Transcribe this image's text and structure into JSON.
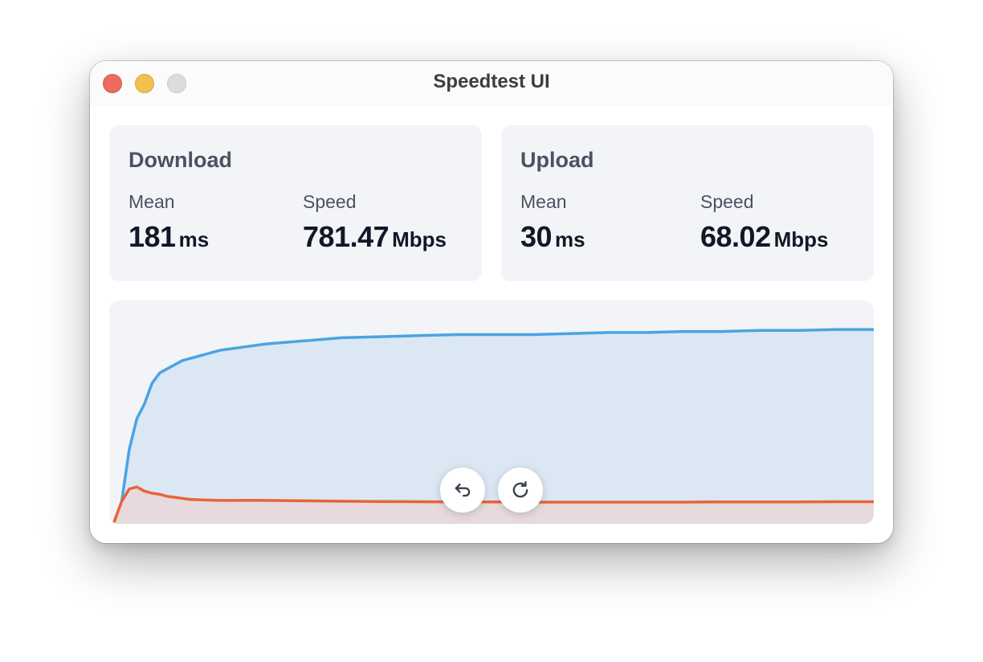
{
  "window": {
    "title": "Speedtest UI"
  },
  "download": {
    "title": "Download",
    "mean_label": "Mean",
    "mean_value": "181",
    "mean_unit": "ms",
    "speed_label": "Speed",
    "speed_value": "781.47",
    "speed_unit": "Mbps"
  },
  "upload": {
    "title": "Upload",
    "mean_label": "Mean",
    "mean_value": "30",
    "mean_unit": "ms",
    "speed_label": "Speed",
    "speed_value": "68.02",
    "speed_unit": "Mbps"
  },
  "buttons": {
    "undo_icon": "undo-arrow-icon",
    "reload_icon": "reload-icon"
  },
  "colors": {
    "download_line": "#4ba3e3",
    "download_fill": "#dbe8f3",
    "upload_line": "#e8643a",
    "upload_fill": "#e6dadc",
    "close": "#ec6a5e",
    "minimize": "#f4bf4f",
    "zoom": "#dcdcdc"
  },
  "chart_data": {
    "type": "area",
    "x": [
      0,
      1,
      2,
      3,
      4,
      5,
      6,
      7,
      8,
      9,
      10,
      12,
      14,
      16,
      18,
      20,
      25,
      30,
      35,
      40,
      45,
      50,
      55,
      60,
      65,
      70,
      75,
      80,
      85,
      90,
      95,
      100
    ],
    "series": [
      {
        "values": [
          0,
          10,
          35,
          50,
          57,
          67,
          72,
          74,
          76,
          78,
          79,
          81,
          83,
          84,
          85,
          86,
          87.5,
          89,
          89.5,
          90,
          90.5,
          90.5,
          90.5,
          91,
          91.5,
          91.5,
          92,
          92,
          92.5,
          92.5,
          93,
          93
        ]
      },
      {
        "values": [
          0,
          10,
          16,
          17,
          15,
          14,
          13.5,
          12.5,
          12,
          11.5,
          11,
          10.7,
          10.5,
          10.5,
          10.6,
          10.5,
          10.3,
          10.1,
          10,
          9.9,
          9.8,
          9.8,
          9.7,
          9.7,
          9.7,
          9.7,
          9.7,
          9.8,
          9.8,
          9.8,
          9.9,
          9.9
        ]
      }
    ],
    "ylim": [
      0,
      100
    ],
    "grid": false
  }
}
